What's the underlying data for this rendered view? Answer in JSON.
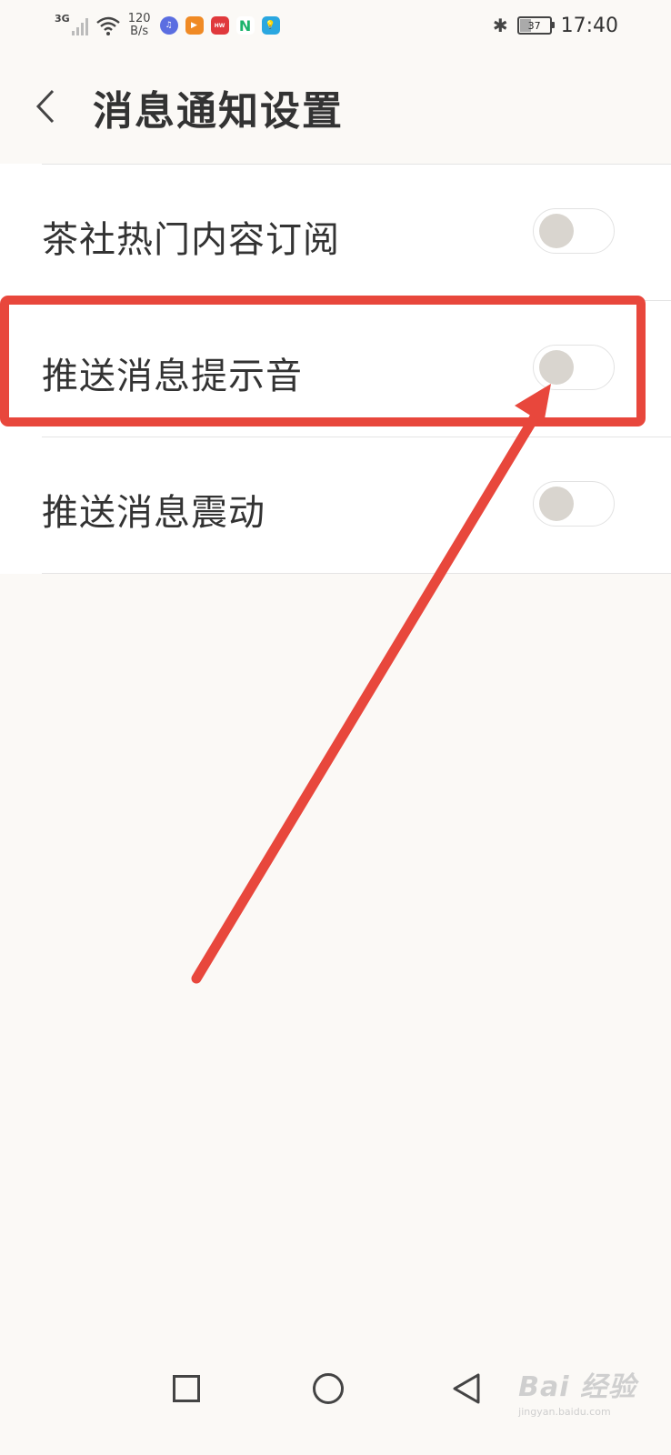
{
  "status_bar": {
    "signal_label": "3G",
    "net_speed_value": "120",
    "net_speed_unit": "B/s",
    "battery_level": "37",
    "time": "17:40",
    "app_icons": [
      {
        "name": "music-app-icon",
        "color": "#5b6ee1"
      },
      {
        "name": "video-app-icon",
        "color": "#f08a24"
      },
      {
        "name": "huawei-app-icon",
        "color": "#e0393c"
      },
      {
        "name": "n-app-icon",
        "color": "#1bb36b"
      },
      {
        "name": "tips-app-icon",
        "color": "#2aa7e0"
      }
    ]
  },
  "header": {
    "title": "消息通知设置",
    "back_icon": "chevron-left-icon"
  },
  "settings": {
    "items": [
      {
        "label": "茶社热门内容订阅",
        "enabled": false
      },
      {
        "label": "推送消息提示音",
        "enabled": false
      },
      {
        "label": "推送消息震动",
        "enabled": false
      }
    ]
  },
  "annotation": {
    "color": "#e8473c",
    "target": "推送消息提示音"
  },
  "nav_bar": {
    "buttons": [
      "recent-apps-icon",
      "home-icon",
      "back-triangle-icon"
    ]
  },
  "watermark": {
    "main": "Bai 经验",
    "sub": "jingyan.baidu.com"
  }
}
